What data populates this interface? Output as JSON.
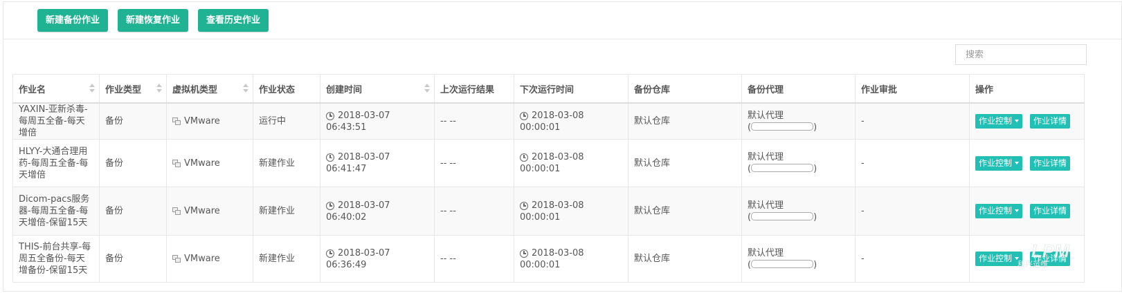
{
  "toolbar": {
    "new_backup": "新建备份作业",
    "new_restore": "新建恢复作业",
    "history": "查看历史作业"
  },
  "search": {
    "placeholder": "搜索"
  },
  "columns": [
    "作业名",
    "作业类型",
    "虚拟机类型",
    "作业状态",
    "创建时间",
    "上次运行结果",
    "下次运行时间",
    "备份仓库",
    "备份代理",
    "作业审批",
    "操作"
  ],
  "rows": [
    {
      "name": "YAXIN-亚新杀毒-每周五全备-每天增倍",
      "type": "备份",
      "vm_type": "VMware",
      "status": "运行中",
      "created": "2018-03-07 06:43:51",
      "last_result": "-- --",
      "next_run": "2018-03-08 00:00:01",
      "repo": "默认仓库",
      "agent": "默认代理",
      "approval": "-",
      "control": "作业控制",
      "detail": "作业详情"
    },
    {
      "name": "HLYY-大通合理用药-每周五全备-每天增倍",
      "type": "备份",
      "vm_type": "VMware",
      "status": "新建作业",
      "created": "2018-03-07 06:41:47",
      "last_result": "-- --",
      "next_run": "2018-03-08 00:00:01",
      "repo": "默认仓库",
      "agent": "默认代理",
      "approval": "-",
      "control": "作业控制",
      "detail": "作业详情"
    },
    {
      "name": "Dicom-pacs服务器-每周五全备-每天增倍-保留15天",
      "type": "备份",
      "vm_type": "VMware",
      "status": "新建作业",
      "created": "2018-03-07 06:40:02",
      "last_result": "-- --",
      "next_run": "2018-03-08 00:00:01",
      "repo": "默认仓库",
      "agent": "默认代理",
      "approval": "-",
      "control": "作业控制",
      "detail": "作业详情"
    },
    {
      "name": "THIS-前台共享-每周五全备份-每天增备份-保留15天",
      "type": "备份",
      "vm_type": "VMware",
      "status": "新建作业",
      "created": "2018-03-07 06:36:49",
      "last_result": "-- --",
      "next_run": "2018-03-08 00:00:01",
      "repo": "默认仓库",
      "agent": "默认代理",
      "approval": "-",
      "control": "作业控制",
      "detail": "作业详情"
    }
  ],
  "watermark": {
    "text": "LPM",
    "subtext": "和兴运维"
  },
  "colors": {
    "primary": "#1fb394",
    "action": "#22c0b4"
  }
}
